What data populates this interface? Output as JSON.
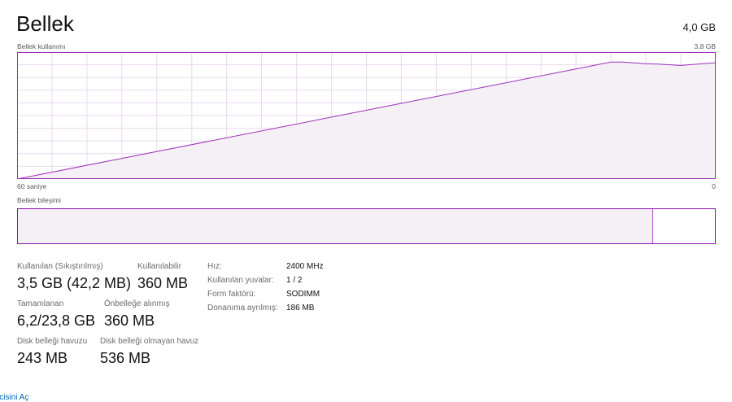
{
  "header": {
    "title": "Bellek",
    "total": "4,0 GB"
  },
  "usage_chart": {
    "label": "Bellek kullanımı",
    "max_label": "3,8 GB",
    "left_axis_label": "60 saniye",
    "right_axis_label": "0",
    "line_color": "#9b30b8",
    "fill_color": "#f4f0f5",
    "grid_color": "#ead8ef"
  },
  "chart_data": {
    "type": "area",
    "x": [
      60,
      9,
      8,
      6,
      5,
      3,
      0
    ],
    "y": [
      0,
      3.5,
      3.5,
      3.45,
      3.44,
      3.4,
      3.48
    ],
    "xlabel": "60 saniye",
    "ylabel": "",
    "xlim": [
      60,
      0
    ],
    "ylim": [
      0,
      3.8
    ],
    "grid": true
  },
  "composition": {
    "label": "Bellek bileşimi",
    "in_use_fraction": 0.91
  },
  "stats": {
    "in_use_label": "Kullanılan (Sıkıştırılmış)",
    "in_use_value": "3,5 GB (42,2 MB)",
    "available_label": "Kullanılabilir",
    "available_value": "360 MB",
    "committed_label": "Tamamlanan",
    "committed_value": "6,2/23,8 GB",
    "cached_label": "Önbelleğe alınmış",
    "cached_value": "360 MB",
    "paged_pool_label": "Disk belleği havuzu",
    "paged_pool_value": "243 MB",
    "nonpaged_pool_label": "Disk belleği olmayan havuz",
    "nonpaged_pool_value": "536 MB"
  },
  "hardware": {
    "speed_label": "Hız:",
    "speed_value": "2400 MHz",
    "slots_label": "Kullanılan yuvalar:",
    "slots_value": "1 / 2",
    "form_label": "Form faktörü:",
    "form_value": "SODIMM",
    "reserved_label": "Donanıma ayrılmış:",
    "reserved_value": "186 MB"
  },
  "footer": {
    "link_text": "icisini Aç"
  }
}
